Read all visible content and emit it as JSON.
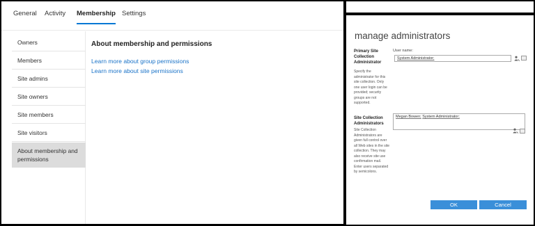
{
  "tabs": [
    "General",
    "Activity",
    "Membership",
    "Settings"
  ],
  "sidebar": {
    "items": [
      {
        "label": "Owners"
      },
      {
        "label": "Members"
      },
      {
        "label": "Site admins"
      },
      {
        "label": "Site owners"
      },
      {
        "label": "Site members"
      },
      {
        "label": "Site visitors"
      },
      {
        "label": "About membership and permissions"
      }
    ]
  },
  "content": {
    "heading": "About membership and permissions",
    "link_group": "Learn more about group permissions",
    "link_site": "Learn more about site permissions"
  },
  "dialog": {
    "title": "manage administrators",
    "primary": {
      "title": "Primary Site Collection Administrator",
      "description": "Specify the administrator for this site collection. Only one user login can be provided; security groups are not supported.",
      "field_label": "User name:",
      "value": "System Administrator;"
    },
    "collection": {
      "title": "Site Collection Administrators",
      "description": "Site Collection Administrators are given full control over all Web sites in the site collection. They may also receive site use confirmation mail. Enter users separated by semicolons.",
      "user1": "Megan Bowen;",
      "user2": "System Administrator;"
    },
    "ok_label": "OK",
    "cancel_label": "Cancel"
  },
  "colors": {
    "accent": "#0078d4",
    "link": "#1a73c8",
    "button": "#3a8fd9",
    "active_nav": "#dcdcdc"
  },
  "icons": [
    "people-picker-icon",
    "address-book-icon"
  ]
}
